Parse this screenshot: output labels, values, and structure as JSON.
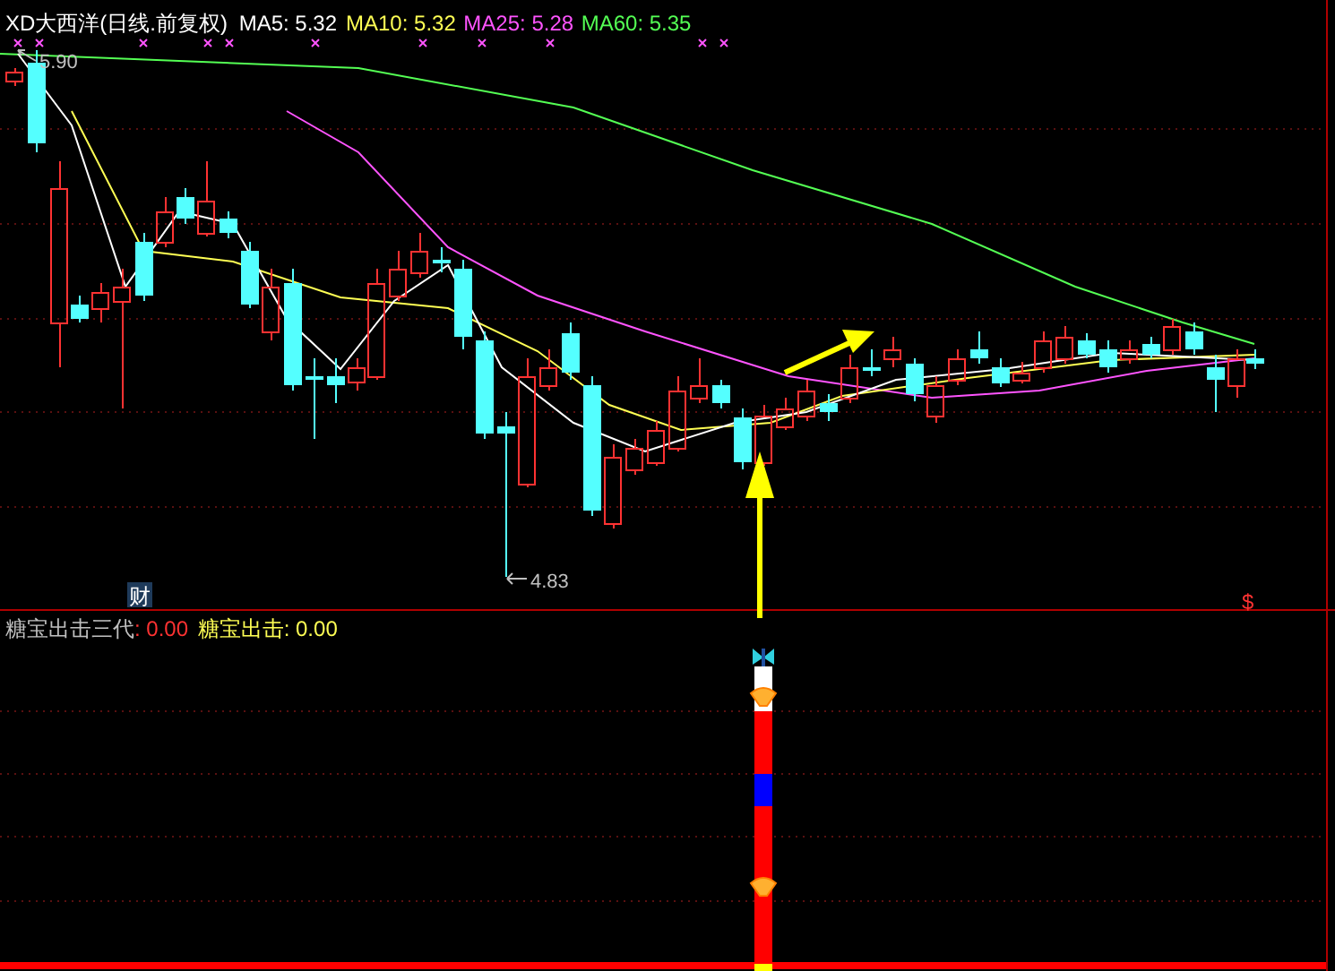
{
  "title": "XD大西洋(日线.前复权)",
  "moving_averages": [
    {
      "label": "MA5: 5.32",
      "color": "#ffffff"
    },
    {
      "label": "MA10: 5.32",
      "color": "#ffff54"
    },
    {
      "label": "MA25: 5.28",
      "color": "#ff54ff"
    },
    {
      "label": "MA60: 5.35",
      "color": "#54ff54"
    }
  ],
  "high_label": "5.90",
  "low_label": "4.83",
  "finance_badge": "财",
  "dividend_mark": "$",
  "indicator_legend": [
    {
      "text": "糖宝出击三代",
      "color": "#c0c0c0"
    },
    {
      "text": ": 0.00",
      "color": "#ff3232"
    },
    {
      "text": "糖宝出击: 0.00",
      "color": "#ffff54"
    }
  ],
  "signal_column": [
    {
      "kind": "butterfly"
    },
    {
      "kind": "bar",
      "color": "#ffffff"
    },
    {
      "kind": "ingot"
    },
    {
      "kind": "bar",
      "color": "#ff0000"
    },
    {
      "kind": "bar",
      "color": "#0000ff"
    },
    {
      "kind": "bar",
      "color": "#ff0000"
    },
    {
      "kind": "ingot"
    },
    {
      "kind": "bar",
      "color": "#ff0000"
    },
    {
      "kind": "bar",
      "color": "#ffff00"
    }
  ]
}
